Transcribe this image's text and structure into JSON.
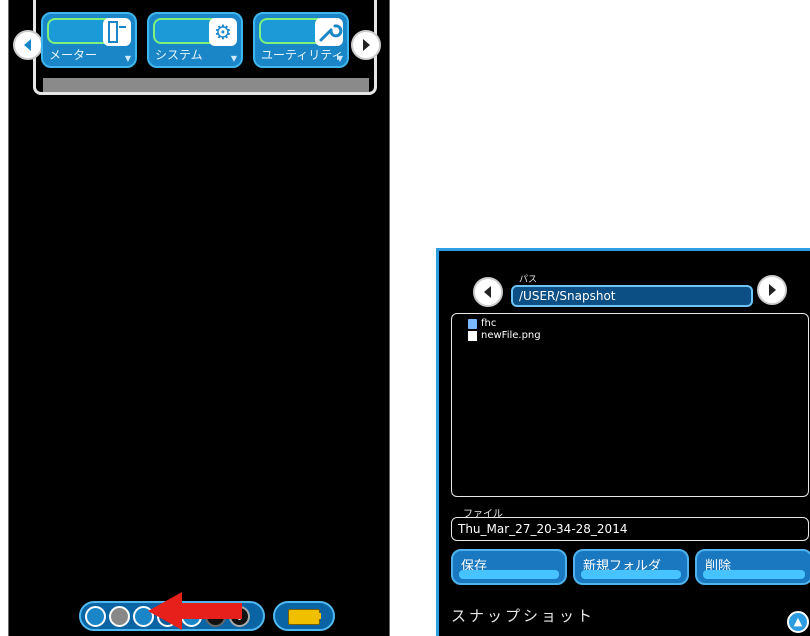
{
  "left_panel": {
    "tiles": [
      {
        "label": "メーター",
        "icon": "meter-icon"
      },
      {
        "label": "システム",
        "icon": "gear-icon"
      },
      {
        "label": "ユーティリティ",
        "icon": "wrench-icon"
      }
    ],
    "bottom_bar_icons": [
      "circle-blue-icon",
      "scope-icon",
      "camera-icon",
      "chart-icon",
      "globe-icon",
      "dot-icon",
      "alert-icon"
    ],
    "battery_icon": "battery-icon",
    "annotation": "red-arrow-icon"
  },
  "snapshot_dialog": {
    "path_label": "パス",
    "path_value": "/USER/Snapshot",
    "files": [
      {
        "name": "fhc",
        "type": "folder"
      },
      {
        "name": "newFile.png",
        "type": "file"
      }
    ],
    "file_label": "ファイル",
    "file_value": "Thu_Mar_27_20-34-28_2014",
    "buttons": {
      "save": "保存",
      "new_folder": "新規フォルダ",
      "delete": "削除"
    },
    "title": "スナップショット"
  },
  "colors": {
    "accent": "#2b9de0",
    "tile_blue": "#1a86c8",
    "highlight_green": "#7df07d",
    "arrow_red": "#e8201c",
    "battery_yellow": "#f0c000"
  }
}
